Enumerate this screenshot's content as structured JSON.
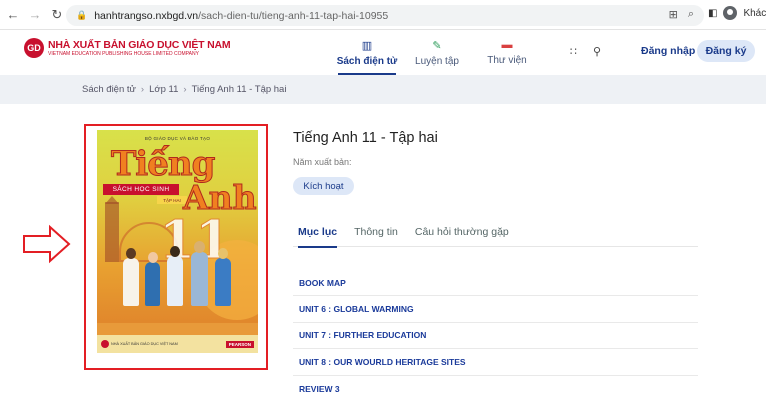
{
  "browser": {
    "url_host": "hanhtrangso.nxbgd.vn",
    "url_path": "/sach-dien-tu/tieng-anh-11-tap-hai-10955",
    "profile_label": "Khách"
  },
  "logo": {
    "mark": "GD",
    "name": "NHÀ XUẤT BẢN GIÁO DỤC VIỆT NAM",
    "sub": "VIETNAM EDUCATION PUBLISHING HOUSE LIMITED COMPANY"
  },
  "nav": {
    "items": [
      {
        "label": "Sách điện tử",
        "icon": "book-icon"
      },
      {
        "label": "Luyện tập",
        "icon": "pen-icon"
      },
      {
        "label": "Thư viện",
        "icon": "library-icon"
      }
    ],
    "login": "Đăng nhập",
    "register": "Đăng ký"
  },
  "breadcrumb": [
    "Sách điện tử",
    "Lớp 11",
    "Tiếng Anh 11 - Tập hai"
  ],
  "cover": {
    "ministry": "BỘ GIÁO DỤC VÀ ĐÀO TẠO",
    "word1": "Tiếng",
    "word2": "Anh",
    "subtitle": "SÁCH HỌC SINH",
    "volume": "TẬP HAI",
    "grade": "11",
    "publisher": "NHÀ XUẤT BẢN GIÁO DỤC VIỆT NAM",
    "partner": "PEARSON"
  },
  "book": {
    "title": "Tiếng Anh 11 - Tập hai",
    "year_label": "Năm xuất bản:",
    "activate": "Kích hoạt"
  },
  "tabs": [
    "Mục lục",
    "Thông tin",
    "Câu hỏi thường gặp"
  ],
  "toc": [
    "BOOK MAP",
    "UNIT 6 : GLOBAL WARMING",
    "UNIT 7 : FURTHER EDUCATION",
    "UNIT 8 : OUR WOURLD HERITAGE SITES",
    "REVIEW 3"
  ],
  "colors": {
    "accent": "#1a3a8a",
    "highlight_frame": "#e31e24",
    "brand_red": "#c8102e"
  }
}
